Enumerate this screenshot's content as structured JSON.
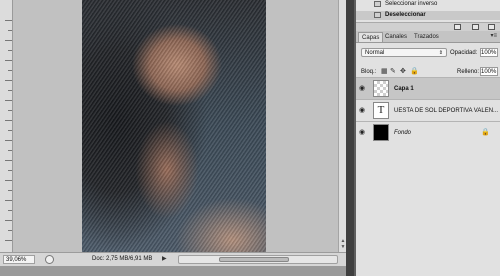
{
  "document": {
    "zoom": "39,06%",
    "doc_size": "Doc: 2,75 MB/6,91 MB",
    "status_arrow_icon": "triangle-right-icon"
  },
  "history": {
    "items": [
      {
        "label": "Seleccionar inverso",
        "selected": false
      },
      {
        "label": "Deseleccionar",
        "selected": true
      }
    ]
  },
  "layers_panel": {
    "tabs": [
      {
        "label": "Capas",
        "active": true
      },
      {
        "label": "Canales",
        "active": false
      },
      {
        "label": "Trazados",
        "active": false
      }
    ],
    "blend_mode": "Normal",
    "opacity_label": "Opacidad:",
    "opacity_value": "100%",
    "lock_label": "Bloq.:",
    "fill_label": "Relleno:",
    "fill_value": "100%",
    "layers": [
      {
        "name": "Capa 1",
        "thumb": "checker",
        "visible": true,
        "selected": true
      },
      {
        "name": "UESTA DE SOL DEPORTIVA VALEN...",
        "thumb": "text",
        "thumb_glyph": "T",
        "visible": true,
        "selected": false
      },
      {
        "name": "Fondo",
        "thumb": "black",
        "visible": true,
        "selected": false,
        "locked": true
      }
    ]
  }
}
